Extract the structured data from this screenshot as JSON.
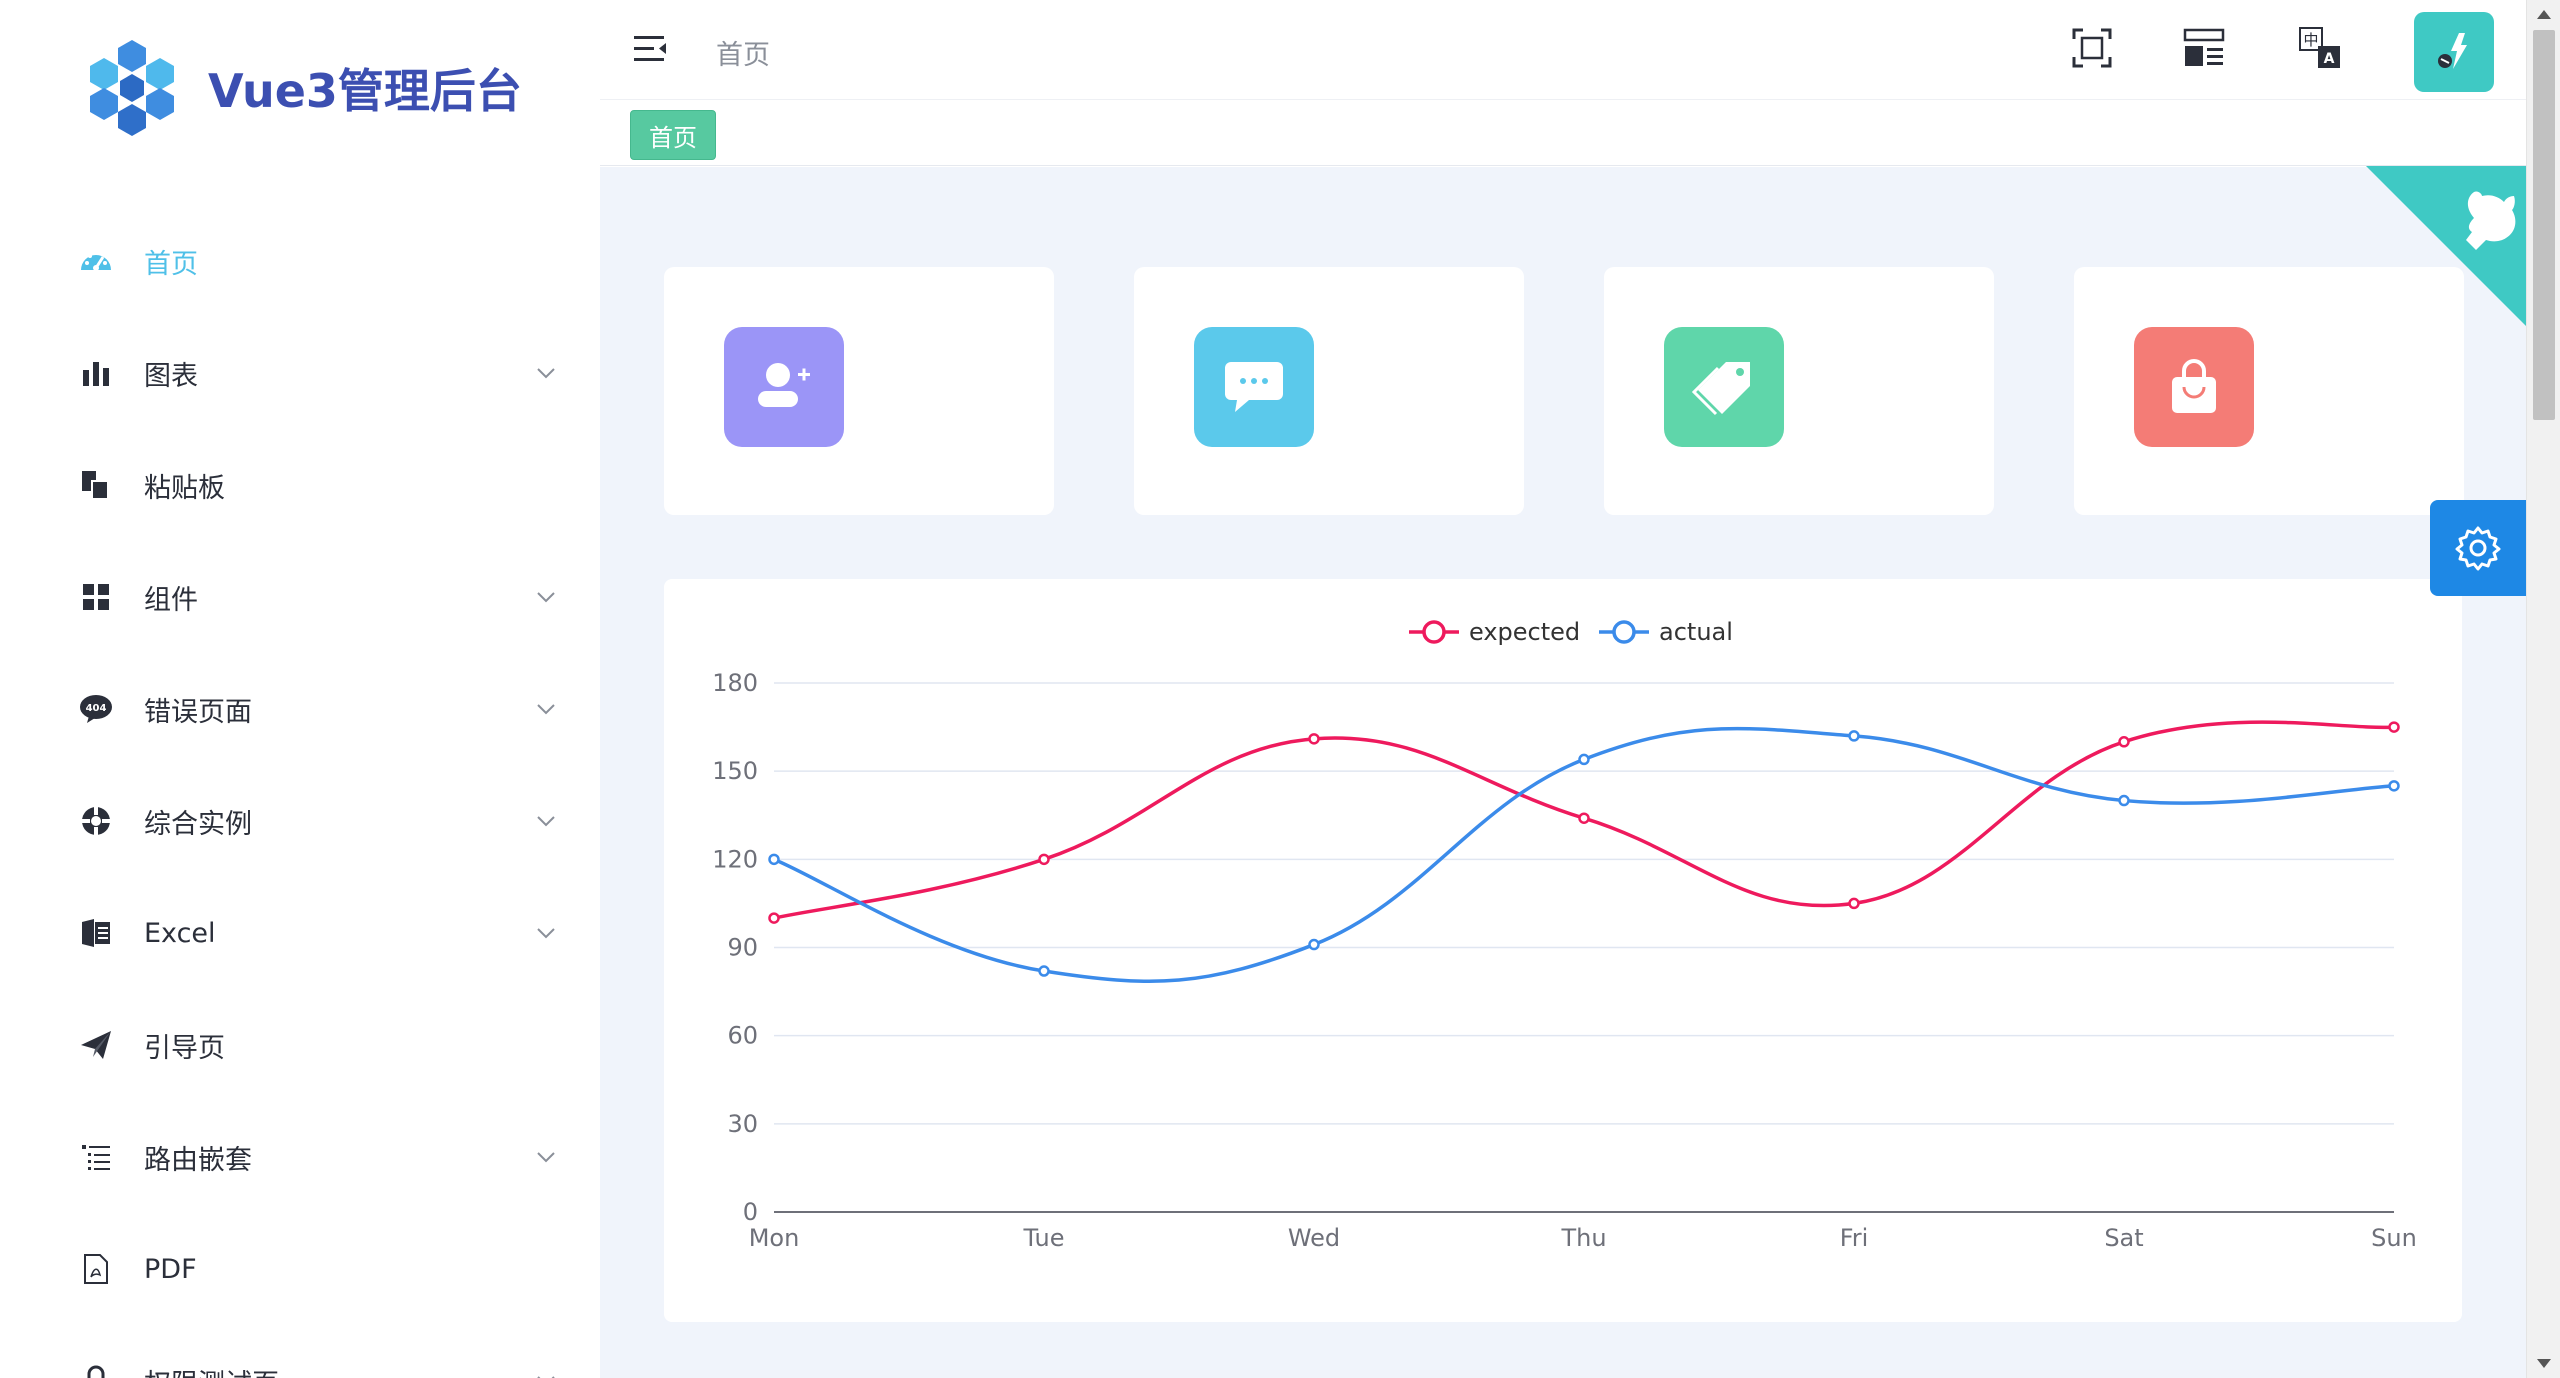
{
  "app": {
    "title": "Vue3管理后台"
  },
  "sidebar": {
    "items": [
      {
        "label": "首页",
        "icon": "dashboard-icon",
        "active": true,
        "expandable": false
      },
      {
        "label": "图表",
        "icon": "bar-chart-icon",
        "active": false,
        "expandable": true
      },
      {
        "label": "粘贴板",
        "icon": "clipboard-icon",
        "active": false,
        "expandable": false
      },
      {
        "label": "组件",
        "icon": "grid-icon",
        "active": false,
        "expandable": true
      },
      {
        "label": "错误页面",
        "icon": "error-404-icon",
        "active": false,
        "expandable": true
      },
      {
        "label": "综合实例",
        "icon": "example-icon",
        "active": false,
        "expandable": true
      },
      {
        "label": "Excel",
        "icon": "excel-icon",
        "active": false,
        "expandable": true
      },
      {
        "label": "引导页",
        "icon": "paper-plane-icon",
        "active": false,
        "expandable": false
      },
      {
        "label": "路由嵌套",
        "icon": "nested-list-icon",
        "active": false,
        "expandable": true
      },
      {
        "label": "PDF",
        "icon": "pdf-icon",
        "active": false,
        "expandable": false
      },
      {
        "label": "权限测试页",
        "icon": "lock-icon",
        "active": false,
        "expandable": true
      }
    ]
  },
  "header": {
    "breadcrumb": "首页",
    "icons": [
      "fullscreen-icon",
      "layout-icon",
      "translate-icon"
    ]
  },
  "tags": [
    {
      "label": "首页",
      "active": true
    }
  ],
  "cards": [
    {
      "icon": "add-user-icon",
      "color": "#9b95f7"
    },
    {
      "icon": "message-icon",
      "color": "#5bc9eb"
    },
    {
      "icon": "tag-icon",
      "color": "#5fd6aa"
    },
    {
      "icon": "shopping-bag-icon",
      "color": "#f47c76"
    }
  ],
  "colors": {
    "accent": "#4fc0e8",
    "tag": "#57c9a0",
    "expected": "#ee1a5d",
    "actual": "#3b8bea",
    "settings": "#1e88e5"
  },
  "chart_data": {
    "type": "line",
    "categories": [
      "Mon",
      "Tue",
      "Wed",
      "Thu",
      "Fri",
      "Sat",
      "Sun"
    ],
    "series": [
      {
        "name": "expected",
        "values": [
          100,
          120,
          161,
          134,
          105,
          160,
          165
        ]
      },
      {
        "name": "actual",
        "values": [
          120,
          82,
          91,
          154,
          162,
          140,
          145
        ]
      }
    ],
    "ylim": [
      0,
      180
    ],
    "yticks": [
      "0",
      "30",
      "60",
      "90",
      "120",
      "150",
      "180"
    ],
    "legend": "top-center",
    "smooth": true,
    "grid": true
  }
}
